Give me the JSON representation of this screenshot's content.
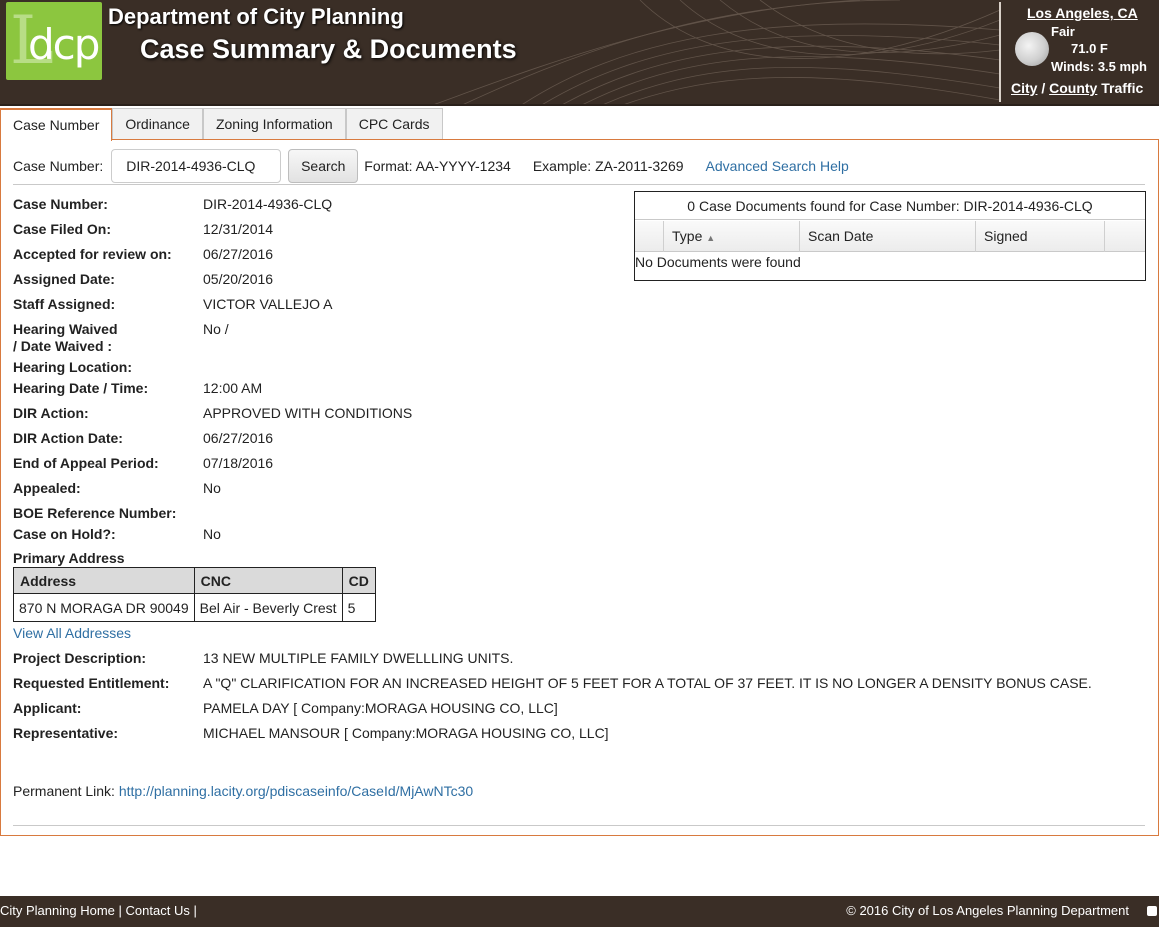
{
  "header": {
    "logo_text": "dcp",
    "logo_mark": "L",
    "department": "Department of City Planning",
    "title": "Case Summary & Documents",
    "weather": {
      "city": "Los Angeles, CA",
      "condition": "Fair",
      "temperature": "71.0 F",
      "winds": "Winds: 3.5 mph",
      "icon": "moon-icon",
      "traffic_city": "City",
      "traffic_sep": "/",
      "traffic_county": "County",
      "traffic_label": "Traffic"
    },
    "colors": {
      "bar": "#3a2e26",
      "logo": "#8cc63f",
      "accent": "#d87a3f"
    }
  },
  "tabs": [
    {
      "label": "Case Number",
      "active": true
    },
    {
      "label": "Ordinance"
    },
    {
      "label": "Zoning Information"
    },
    {
      "label": "CPC Cards"
    }
  ],
  "search": {
    "label": "Case Number:",
    "value": "DIR-2014-4936-CLQ",
    "button": "Search",
    "format": "Format: AA-YYYY-1234",
    "example": "Example: ZA-2011-3269",
    "help_link": "Advanced Search Help"
  },
  "details": [
    {
      "key": "Case Number:",
      "value": "DIR-2014-4936-CLQ"
    },
    {
      "key": "Case Filed On:",
      "value": "12/31/2014"
    },
    {
      "key": "Accepted for review on:",
      "value": "06/27/2016"
    },
    {
      "key": "Assigned Date:",
      "value": "05/20/2016"
    },
    {
      "key": "Staff Assigned:",
      "value": "VICTOR VALLEJO A"
    },
    {
      "key": "Hearing Waived",
      "key2": "/ Date Waived :",
      "value": "No /"
    },
    {
      "key": "Hearing Location:",
      "value": ""
    },
    {
      "key": "Hearing Date / Time:",
      "value": "12:00 AM"
    },
    {
      "key": "DIR Action:",
      "value": "APPROVED WITH CONDITIONS"
    },
    {
      "key": "DIR Action Date:",
      "value": "06/27/2016"
    },
    {
      "key": "End of Appeal Period:",
      "value": "07/18/2016"
    },
    {
      "key": "Appealed:",
      "value": "No"
    },
    {
      "key": "BOE Reference Number:",
      "value": ""
    },
    {
      "key": "Case on Hold?:",
      "value": "No"
    }
  ],
  "address": {
    "title": "Primary Address",
    "columns": [
      "Address",
      "CNC",
      "CD"
    ],
    "rows": [
      [
        "870 N MORAGA DR 90049",
        "Bel Air - Beverly Crest",
        "5"
      ]
    ],
    "view_all": "View All Addresses"
  },
  "details2": [
    {
      "key": "Project Description:",
      "value": "13 NEW MULTIPLE FAMILY DWELLLING UNITS."
    },
    {
      "key": "Requested Entitlement:",
      "value": "A \"Q\" CLARIFICATION FOR AN INCREASED HEIGHT OF 5 FEET FOR A TOTAL OF 37 FEET. IT IS NO LONGER A DENSITY BONUS CASE."
    },
    {
      "key": "Applicant:",
      "value": "PAMELA DAY [ Company:MORAGA HOUSING CO, LLC]"
    },
    {
      "key": "Representative:",
      "value": "MICHAEL MANSOUR [ Company:MORAGA HOUSING CO, LLC]"
    }
  ],
  "permanent": {
    "label": "Permanent Link:",
    "url": "http://planning.lacity.org/pdiscaseinfo/CaseId/MjAwNTc30"
  },
  "documents": {
    "caption": "0 Case Documents found for Case Number: DIR-2014-4936-CLQ",
    "columns": [
      "Type",
      "Scan Date",
      "Signed"
    ],
    "sort_indicator": "▲",
    "empty": "No Documents were found"
  },
  "footer": {
    "home": "City Planning Home",
    "contact": "Contact Us",
    "sep": "|",
    "copyright": "© 2016 City of Los Angeles Planning Department"
  }
}
